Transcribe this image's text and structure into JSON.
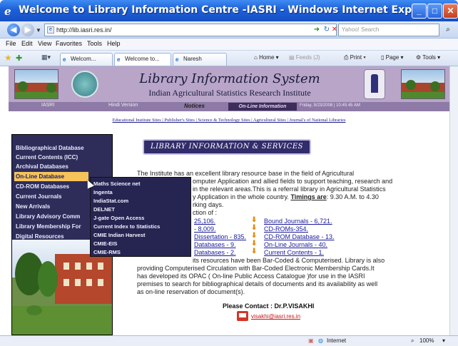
{
  "window": {
    "title": "Welcome to Library Information Centre -IASRI - Windows Internet Explorer",
    "minimize": "_",
    "maximize": "□",
    "close": "✕"
  },
  "address_bar": {
    "url": "http://lib.iasri.res.in/",
    "search_placeholder": "Yahoo! Search"
  },
  "menu": [
    "File",
    "Edit",
    "View",
    "Favorites",
    "Tools",
    "Help"
  ],
  "tabs": [
    {
      "label": "Welcom...",
      "active": false
    },
    {
      "label": "Welcome to...",
      "active": true
    },
    {
      "label": "Naresh",
      "active": false
    }
  ],
  "commands": {
    "home": "Home",
    "feeds": "Feeds (J)",
    "print": "Print",
    "page": "Page",
    "tools": "Tools"
  },
  "header": {
    "title": "Library Information System",
    "subtitle": "Indian Agricultural Statistics Research Institute"
  },
  "navstrip": {
    "left": "IASRI",
    "hindi": "Hindi Version",
    "notices": "Notices",
    "online": "On-Line Information",
    "datestamp": "Friday, 9/23/2008 | 10:45:45 AM"
  },
  "site_links": "Educational Institute Sites | Publisher's Sites | Science & Technology Sites | Agricultural Sites | Journal's of National Libraries",
  "sidebar": {
    "items": [
      "Bibliographical Database",
      "Current Contents (ICC)",
      "Archival Databases",
      "On-Line Database",
      "CD-ROM Databases",
      "Current Journals",
      "New Arrivals",
      "Library Advisory Comm",
      "Library Membership For",
      "Digital Resources"
    ],
    "active_index": 3
  },
  "submenu": [
    "Maths Science net",
    "Ingenta",
    "IndiaStat.com",
    "DELNET",
    "J-gate Open Access",
    "Current Index to Statistics",
    "CMIE Indian Harvest",
    "CMIE-EIS",
    "CMIE-RMS"
  ],
  "section_title": "LIBRARY INFORMATION & SERVICES",
  "intro": {
    "line1": "The Institute has an excellent library resource base in the field of Agricultural",
    "line2": "omputer Application and allied fields to support teaching, research and",
    "line3": "in the relevant areas.This is a referral library in Agricultural Statistics",
    "line4_a": "y Application in the whole country.",
    "timings_label": "Timings are",
    "line4_b": ": 9.30 A.M. to 4.30",
    "line5": "rking days.",
    "line6": "ction of :"
  },
  "collection_left": [
    "25,106.",
    "- 8,009.",
    "Dissertation - 835.",
    "Databases - 9.",
    "Databases - 2."
  ],
  "collection_right": [
    "Bound Journals - 6,721.",
    "CD-ROMs-354.",
    "CD-ROM Database - 13.",
    "On-Line Journals - 40.",
    "Current Contents - 1."
  ],
  "closing": {
    "line1": "its resources have been Bar-Coded & Computerised. Library is also",
    "line2": "providing Computerised Circulation with Bar-Coded Electronic Membership Cards.It",
    "line3": "has developed its OPAC ( On-line Public Access Catalogue )for use in the IASRI",
    "line4": "premises to search for bibliographical details of documents and its availability as well",
    "line5": "as on-line reservation of document(s)."
  },
  "contact": {
    "label": "Please Contact : Dr.P.VISAKHI",
    "email": "visakhi@iasri.res.in"
  },
  "status": {
    "zone": "Internet",
    "zoom": "100%"
  }
}
